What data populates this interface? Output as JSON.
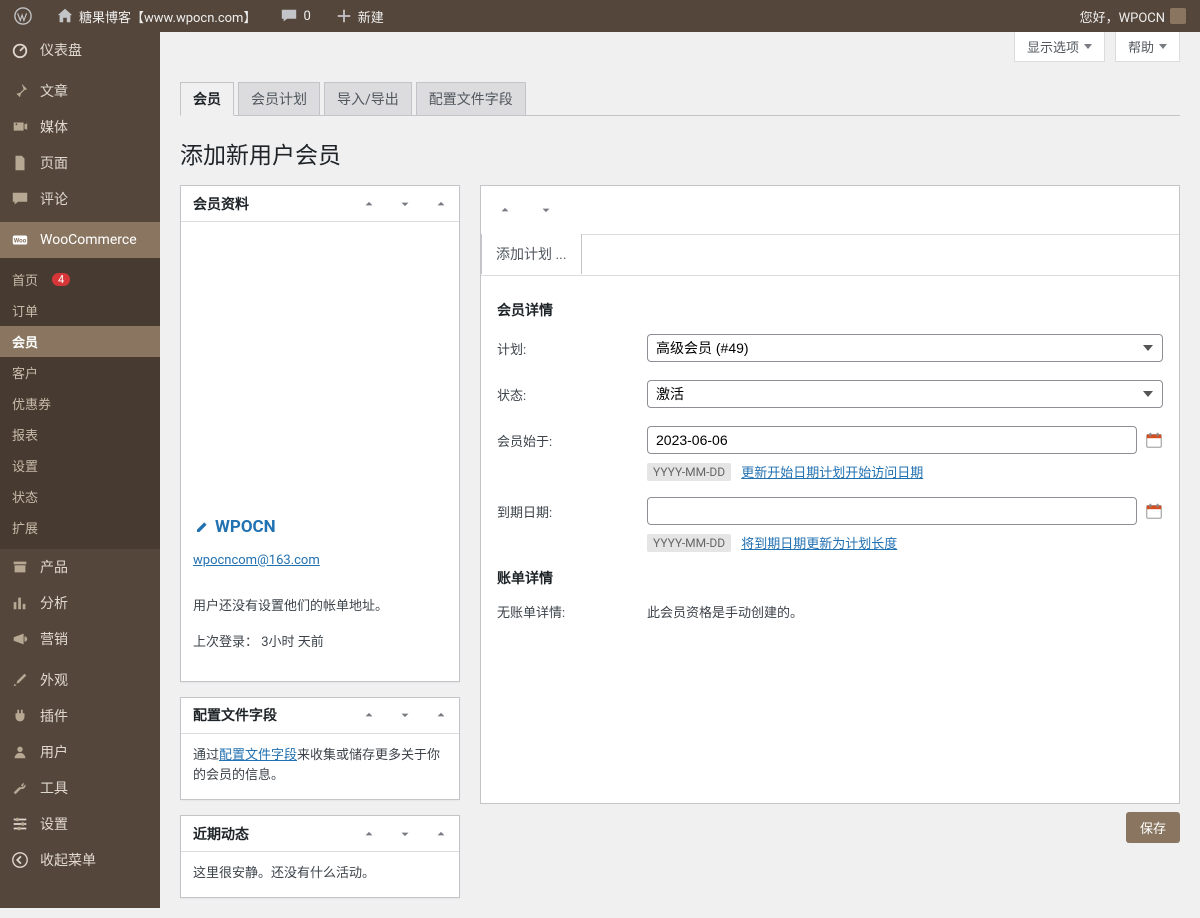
{
  "adminbar": {
    "site_name": "糖果博客【www.wpocn.com】",
    "comments_count": "0",
    "new_label": "新建",
    "greeting": "您好，WPOCN"
  },
  "screen_meta": {
    "screen_options": "显示选项",
    "help": "帮助"
  },
  "sidebar": {
    "items": [
      {
        "id": "dashboard",
        "label": "仪表盘"
      },
      {
        "id": "posts",
        "label": "文章"
      },
      {
        "id": "media",
        "label": "媒体"
      },
      {
        "id": "pages",
        "label": "页面"
      },
      {
        "id": "comments",
        "label": "评论"
      },
      {
        "id": "woocommerce",
        "label": "WooCommerce"
      },
      {
        "id": "products",
        "label": "产品"
      },
      {
        "id": "analytics",
        "label": "分析"
      },
      {
        "id": "marketing",
        "label": "营销"
      },
      {
        "id": "appearance",
        "label": "外观"
      },
      {
        "id": "plugins",
        "label": "插件"
      },
      {
        "id": "users",
        "label": "用户"
      },
      {
        "id": "tools",
        "label": "工具"
      },
      {
        "id": "settings",
        "label": "设置"
      },
      {
        "id": "collapse",
        "label": "收起菜单"
      }
    ],
    "wc_submenu": [
      {
        "label": "首页",
        "badge": "4"
      },
      {
        "label": "订单"
      },
      {
        "label": "会员",
        "current": true
      },
      {
        "label": "客户"
      },
      {
        "label": "优惠券"
      },
      {
        "label": "报表"
      },
      {
        "label": "设置"
      },
      {
        "label": "状态"
      },
      {
        "label": "扩展"
      }
    ]
  },
  "tabs": [
    {
      "label": "会员",
      "active": true
    },
    {
      "label": "会员计划"
    },
    {
      "label": "导入/导出"
    },
    {
      "label": "配置文件字段"
    }
  ],
  "page": {
    "title": "添加新用户会员"
  },
  "boxes": {
    "member_data": {
      "title": "会员资料",
      "username": "WPOCN",
      "email": "wpocncom@163.com",
      "no_address": "用户还没有设置他们的帐单地址。",
      "last_login_label": "上次登录：",
      "last_login_value": "3小时 天前"
    },
    "profile_fields": {
      "title": "配置文件字段",
      "text_prefix": "通过",
      "link": "配置文件字段",
      "text_suffix": "来收集或储存更多关于你的会员的信息。"
    },
    "recent": {
      "title": "近期动态",
      "text": "这里很安静。还没有什么活动。"
    }
  },
  "main": {
    "add_plan_tab": "添加计划 ...",
    "section_member_details": "会员详情",
    "label_plan": "计划:",
    "plan_value": "高级会员 (#49)",
    "label_status": "状态:",
    "status_value": "激活",
    "label_start": "会员始于:",
    "start_value": "2023-06-06",
    "hint_format": "YYYY-MM-DD",
    "hint_start_link": "更新开始日期计划开始访问日期",
    "label_expire": "到期日期:",
    "expire_value": "",
    "hint_expire_link": "将到期日期更新为计划长度",
    "section_billing": "账单详情",
    "label_no_billing": "无账单详情:",
    "no_billing_text": "此会员资格是手动创建的。",
    "save": "保存"
  }
}
